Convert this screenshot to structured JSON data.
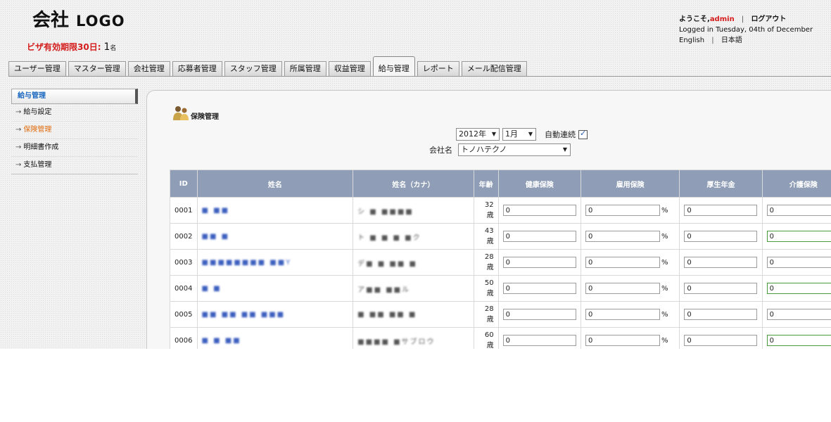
{
  "header": {
    "logo_company": "会社",
    "logo_text": "LOGO",
    "visa_label": "ビザ有効期限30日:",
    "visa_count": "1",
    "visa_unit": "名"
  },
  "user": {
    "welcome": "ようこそ,",
    "name": "admin",
    "logout": "ログアウト",
    "logged_in": "Logged in Tuesday, 04th of December",
    "lang_en": "English",
    "lang_ja": "日本語"
  },
  "tabs": [
    {
      "label": "ユーザー管理"
    },
    {
      "label": "マスター管理"
    },
    {
      "label": "会社管理"
    },
    {
      "label": "応募者管理"
    },
    {
      "label": "スタッフ管理"
    },
    {
      "label": "所属管理"
    },
    {
      "label": "収益管理"
    },
    {
      "label": "給与管理"
    },
    {
      "label": "レポート"
    },
    {
      "label": "メール配信管理"
    }
  ],
  "sidebar": {
    "title": "給与管理",
    "items": [
      {
        "label": "給与設定"
      },
      {
        "label": "保険管理"
      },
      {
        "label": "明細書作成"
      },
      {
        "label": "支払管理"
      }
    ]
  },
  "section": {
    "title": "保険管理"
  },
  "filters": {
    "year": "2012年",
    "month": "1月",
    "auto_label": "自動連続",
    "company_label": "会社名",
    "company_value": "トノハテクノ"
  },
  "table": {
    "headers": [
      "ID",
      "姓名",
      "姓名（カナ）",
      "年齢",
      "健康保険",
      "雇用保険",
      "厚生年金",
      "介護保険"
    ],
    "rows": [
      {
        "id": "0001",
        "name": "■ ■■",
        "kana": "シ ■ ■■■■",
        "age": "32 歳",
        "health": "0",
        "employment": "0",
        "pension": "0",
        "care": "0"
      },
      {
        "id": "0002",
        "name": "■■ ■",
        "kana": "ト ■ ■ ■ ■ク",
        "age": "43 歳",
        "health": "0",
        "employment": "0",
        "pension": "0",
        "care": "0"
      },
      {
        "id": "0003",
        "name": "■■■■■■■■ ■■Y",
        "kana": "デ■ ■ ■■ ■",
        "age": "28 歳",
        "health": "0",
        "employment": "0",
        "pension": "0",
        "care": "0"
      },
      {
        "id": "0004",
        "name": "■ ■",
        "kana": "ア■■ ■■ル",
        "age": "50 歳",
        "health": "0",
        "employment": "0",
        "pension": "0",
        "care": "0"
      },
      {
        "id": "0005",
        "name": "■■ ■■ ■■ ■■■",
        "kana": "■ ■■ ■■ ■",
        "age": "28 歳",
        "health": "0",
        "employment": "0",
        "pension": "0",
        "care": "0"
      },
      {
        "id": "0006",
        "name": "■ ■ ■■",
        "kana": "■■■■ ■サブロウ",
        "age": "60 歳",
        "health": "0",
        "employment": "0",
        "pension": "0",
        "care": "0"
      }
    ],
    "percent_sign": "%"
  }
}
